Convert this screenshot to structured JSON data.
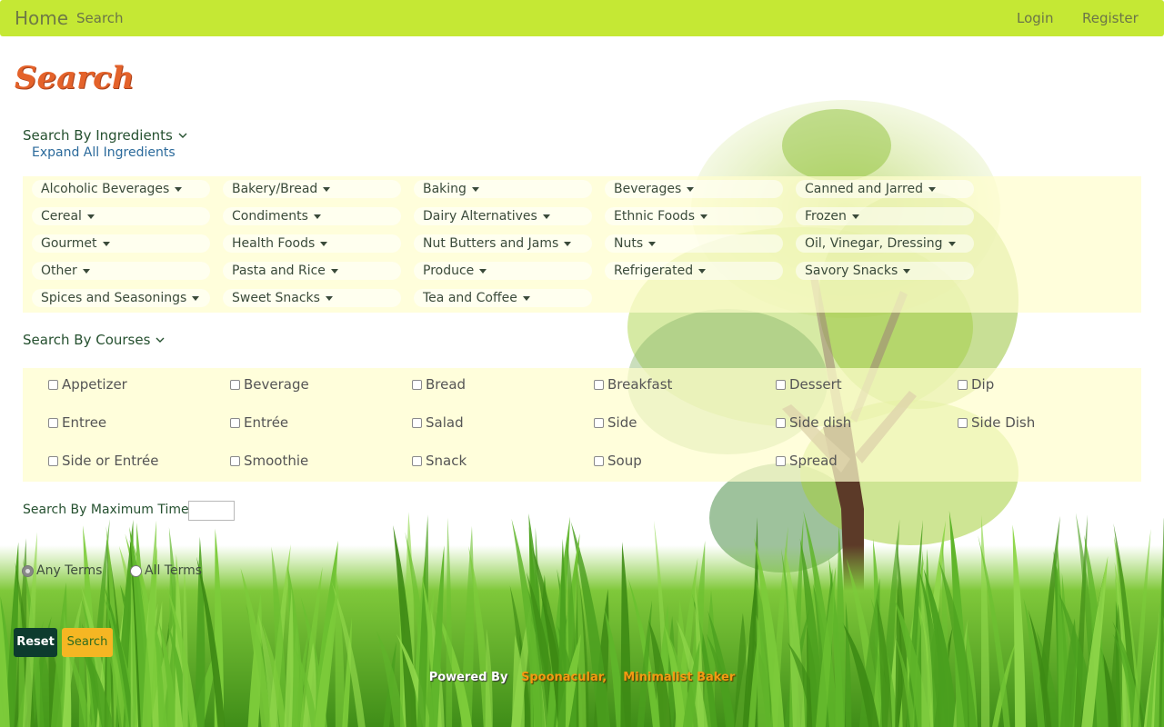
{
  "navbar": {
    "brand": "Home",
    "search": "Search",
    "login": "Login",
    "register": "Register",
    "bg_color": "#c5e834"
  },
  "page": {
    "title": "Search",
    "title_color": "#e4622a"
  },
  "ingredients": {
    "heading": "Search By Ingredients",
    "expand_all": "Expand All Ingredients",
    "items": [
      "Alcoholic Beverages",
      "Bakery/Bread",
      "Baking",
      "Beverages",
      "Canned and Jarred",
      "Cereal",
      "Condiments",
      "Dairy Alternatives",
      "Ethnic Foods",
      "Frozen",
      "Gourmet",
      "Health Foods",
      "Nut Butters and Jams",
      "Nuts",
      "Oil, Vinegar, Dressing",
      "Other",
      "Pasta and Rice",
      "Produce",
      "Refrigerated",
      "Savory Snacks",
      "Spices and Seasonings",
      "Sweet Snacks",
      "Tea and Coffee"
    ]
  },
  "courses": {
    "heading": "Search By Courses",
    "items": [
      "Appetizer",
      "Beverage",
      "Bread",
      "Breakfast",
      "Dessert",
      "Dip",
      "Entree",
      "Entrée",
      "Salad",
      "Side",
      "Side dish",
      "Side Dish",
      "Side or Entrée",
      "Smoothie",
      "Snack",
      "Soup",
      "Spread"
    ]
  },
  "max_time": {
    "label": "Search By Maximum Time:",
    "value": ""
  },
  "terms": {
    "any": "Any Terms",
    "all": "All Terms",
    "selected": "any"
  },
  "buttons": {
    "reset": "Reset",
    "search": "Search"
  },
  "footer": {
    "powered_by": "Powered By",
    "source1": "Spoonacular,",
    "source2": "Minimalist Baker"
  },
  "icons": {
    "heading_toggle": "chevron-down-icon",
    "dropdown": "caret-down-icon"
  }
}
